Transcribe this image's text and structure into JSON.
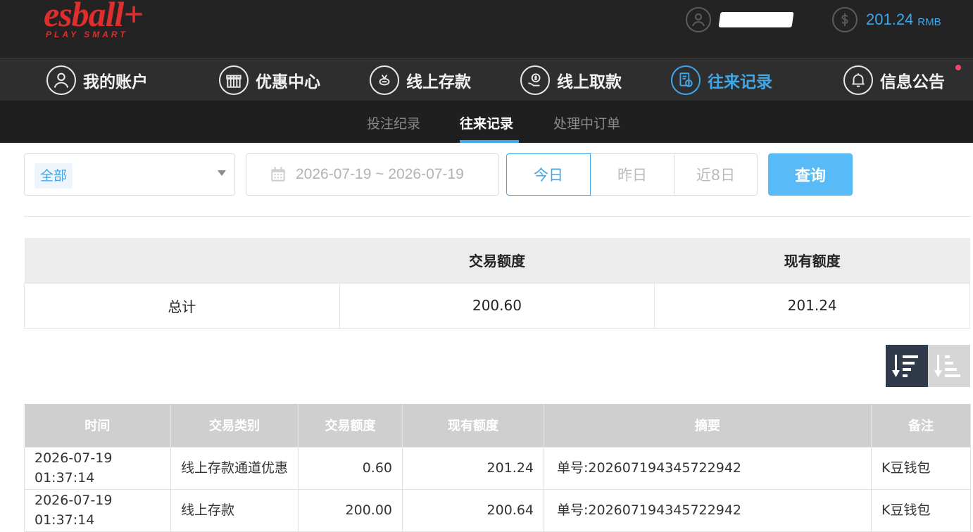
{
  "header": {
    "logo_text": "esball+",
    "logo_tagline": "PLAY SMART",
    "username_masked": "",
    "user_icon": "user-circle-icon",
    "balance_icon": "dollar-circle-icon",
    "balance": "201.24",
    "currency": "RMB"
  },
  "nav": {
    "items": [
      {
        "label": "我的账户",
        "icon": "user-icon"
      },
      {
        "label": "优惠中心",
        "icon": "gift-icon"
      },
      {
        "label": "线上存款",
        "icon": "deposit-icon"
      },
      {
        "label": "线上取款",
        "icon": "withdraw-icon"
      },
      {
        "label": "往来记录",
        "icon": "records-icon",
        "active": true
      },
      {
        "label": "信息公告",
        "icon": "bell-icon"
      }
    ]
  },
  "subnav": {
    "items": [
      "投注纪录",
      "往来记录",
      "处理中订单"
    ],
    "active": "往来记录"
  },
  "filters": {
    "type_selected": "全部",
    "date_range": "2026-07-19 ~ 2026-07-19",
    "quick_ranges": [
      "今日",
      "昨日",
      "近8日"
    ],
    "quick_active": "今日",
    "query_label": "查询"
  },
  "summary": {
    "headers": [
      "",
      "交易额度",
      "现有额度"
    ],
    "row": [
      "总计",
      "200.60",
      "201.24"
    ]
  },
  "sort": {
    "desc_icon": "sort-descending-icon",
    "asc_icon": "sort-ascending-icon",
    "active": "desc"
  },
  "records": {
    "headers": [
      "时间",
      "交易类别",
      "交易额度",
      "现有额度",
      "摘要",
      "备注"
    ],
    "rows": [
      [
        "2026-07-19 01:37:14",
        "线上存款通道优惠",
        "0.60",
        "201.24",
        "单号:202607194345722942",
        "K豆钱包"
      ],
      [
        "2026-07-19 01:37:14",
        "线上存款",
        "200.00",
        "200.64",
        "单号:202607194345722942",
        "K豆钱包"
      ]
    ]
  },
  "colors": {
    "accent": "#3fa6e8",
    "query_button": "#58bbf7",
    "logo_red": "#e02d2d",
    "notify_dot": "#f2476a"
  }
}
